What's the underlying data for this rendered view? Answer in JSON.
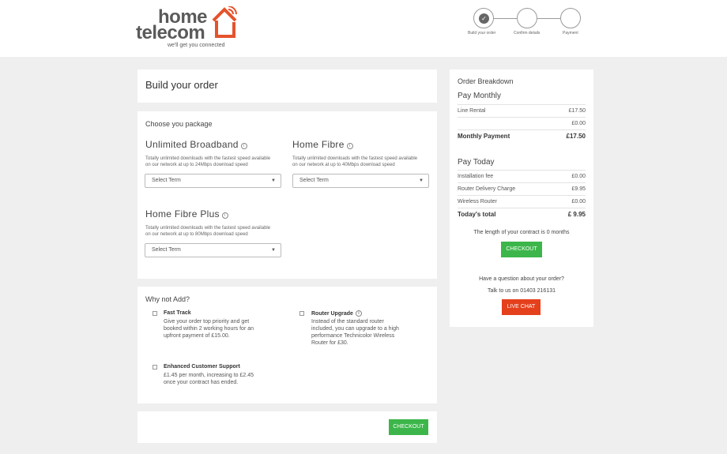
{
  "header": {
    "logo_line1": "home",
    "logo_line2": "telecom",
    "logo_tagline": "we'll get you connected",
    "steps": [
      {
        "label": "Build your order",
        "done": true
      },
      {
        "label": "Confirm details",
        "done": false
      },
      {
        "label": "Payment",
        "done": false
      }
    ]
  },
  "build": {
    "title": "Build your order"
  },
  "packages": {
    "heading": "Choose you package",
    "items": [
      {
        "name": "Unlimited Broadband",
        "desc1": "Totally unlimited downloads with the fastest speed available",
        "desc2": "on our network at up to 24Mbps download speed",
        "select": "Select Term"
      },
      {
        "name": "Home Fibre",
        "desc1": "Totally unlimited downloads with the fastest speed available",
        "desc2": "on our network at up to 40Mbps download speed",
        "select": "Select Term"
      },
      {
        "name": "Home Fibre Plus",
        "desc1": "Totally unlimited downloads with the fastest speed available",
        "desc2": "on our network at up to 80Mbps download speed",
        "select": "Select Term"
      }
    ]
  },
  "addons": {
    "heading": "Why not Add?",
    "items": [
      {
        "title": "Fast Track",
        "lines": [
          "Give your order top priority and get",
          "booked within 2 working hours for an",
          "upfront payment of £15.00."
        ]
      },
      {
        "title": "Router Upgrade",
        "lines": [
          "Instead of the standard router",
          "included, you can upgrade to a high",
          "performance Technicolor Wireless",
          "Router for £30."
        ]
      },
      {
        "title": "Enhanced Customer Support",
        "lines": [
          "£1.45 per month, increasing to £2.45",
          "once your contract has ended."
        ]
      }
    ]
  },
  "bottom": {
    "checkout": "CHECKOUT"
  },
  "breakdown": {
    "title": "Order Breakdown",
    "monthly_heading": "Pay Monthly",
    "monthly_rows": [
      {
        "label": "Line Rental",
        "value": "£17.50"
      },
      {
        "label": "",
        "value": "£0.00"
      }
    ],
    "monthly_total": {
      "label": "Monthly Payment",
      "value": "£17.50"
    },
    "today_heading": "Pay Today",
    "today_rows": [
      {
        "label": "Installation fee",
        "value": "£0.00"
      },
      {
        "label": "Router Delivery Charge",
        "value": "£9.95"
      },
      {
        "label": "Wireless Router",
        "value": "£0.00"
      }
    ],
    "today_total": {
      "label": "Today's total",
      "value": "£ 9.95"
    },
    "contract_text": "The length of your contract is 0 months",
    "checkout": "CHECKOUT",
    "question": "Have a question about your order?",
    "phone_text": "Talk to us on 01403 216131",
    "chat": "LIVE CHAT"
  },
  "colors": {
    "green": "#3cb64a",
    "red": "#e5401c",
    "logo_orange": "#e5532b"
  },
  "icons": [
    "house-logo-icon",
    "check-icon",
    "info-icon",
    "caret-down-icon"
  ]
}
